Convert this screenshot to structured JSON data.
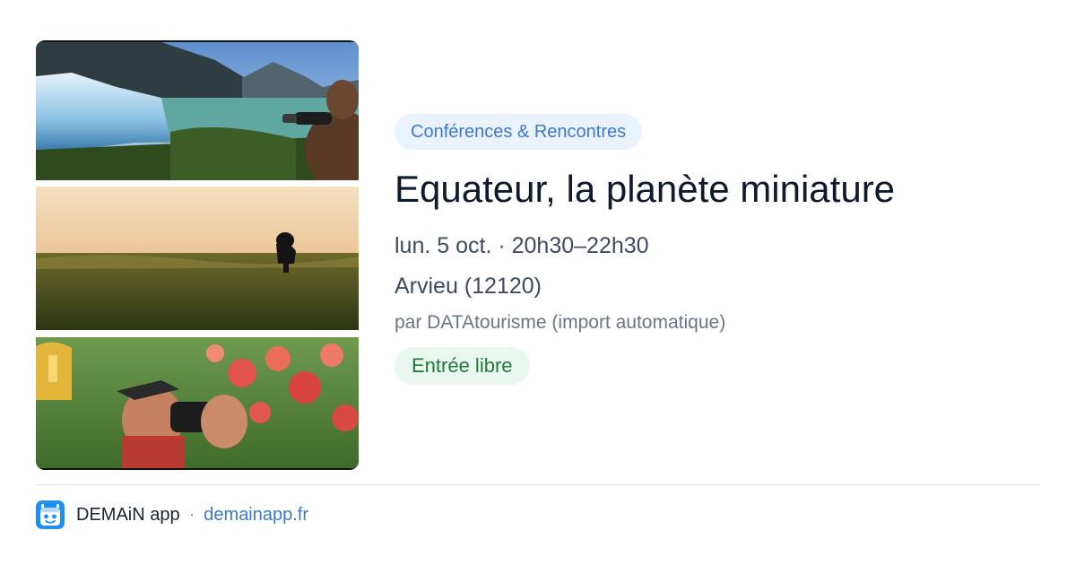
{
  "event": {
    "category": "Conférences & Rencontres",
    "title": "Equateur, la planète miniature",
    "date_time": "lun. 5 oct. · 20h30–22h30",
    "location": "Arvieu (12120)",
    "organizer": "par DATAtourisme (import automatique)",
    "price": "Entrée libre"
  },
  "footer": {
    "app_name": "DEMAiN app",
    "separator": "·",
    "domain": "demainapp.fr",
    "icon": "demain-app-logo-icon"
  },
  "colors": {
    "category_bg": "#eaf2fd",
    "category_text": "#3b78cf",
    "price_bg": "#eaf7ee",
    "price_text": "#1f7a3e",
    "title_text": "#0f1a2c",
    "link": "#3b78cf",
    "app_icon_bg": "#1f8ff0"
  }
}
